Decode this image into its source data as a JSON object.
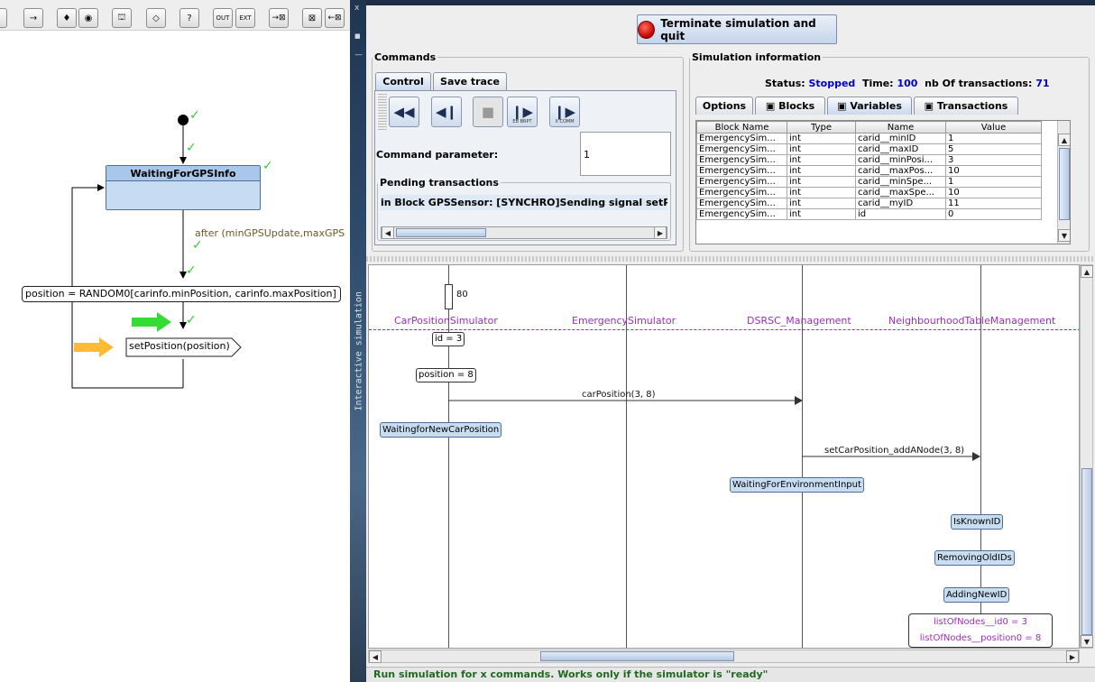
{
  "toolbar": {
    "buttons": [
      {
        "label": "→",
        "icon": "arrow-right-icon"
      },
      {
        "label": "♦",
        "icon": "junction-icon"
      },
      {
        "label": "◉",
        "icon": "stop-state-icon"
      },
      {
        "label": "⛫",
        "icon": "action-state-icon"
      },
      {
        "label": "◇",
        "icon": "choice-icon"
      },
      {
        "label": "?",
        "icon": "receive-icon"
      },
      {
        "label": "OUT",
        "icon": "send-signal-icon"
      },
      {
        "label": "EXT",
        "icon": "external-icon"
      },
      {
        "label": "→⊠",
        "icon": "request-icon"
      },
      {
        "label": "⊠",
        "icon": "clear-icon"
      },
      {
        "label": "←⊠",
        "icon": "receive-request-icon"
      }
    ]
  },
  "diagram": {
    "state_name": "WaitingForGPSInfo",
    "guard": "after (minGPSUpdate,maxGPS",
    "action": "position = RANDOM0[carinfo.minPosition, carinfo.maxPosition]",
    "signal": "setPosition(position)",
    "check": "✓"
  },
  "divider": {
    "vertical_text": "Interactive simulation",
    "icons": [
      "x",
      "■",
      "—"
    ]
  },
  "terminate_button": "Terminate simulation and quit",
  "commands": {
    "legend": "Commands",
    "tabs": [
      "Control",
      "Save trace"
    ],
    "param_label": "Command parameter:",
    "param_value": "1",
    "pending_legend": "Pending transactions",
    "pending_item": "in Block GPSSensor: [SYNCHRO]Sending signal setPosi",
    "btn_labels": {
      "bp": "EB BRPT",
      "xcomm": "X COMM"
    }
  },
  "siminfo": {
    "legend": "Simulation information",
    "status_label": "Status:",
    "status_value": "Stopped",
    "time_label": "Time:",
    "time_value": "100",
    "nb_label": "nb Of transactions:",
    "nb_value": "71",
    "tabs": [
      "Options",
      "Blocks",
      "Variables",
      "Transactions"
    ],
    "columns": [
      "Block Name",
      "Type",
      "Name",
      "Value"
    ],
    "rows": [
      [
        "EmergencySim...",
        "int",
        "carid__minID",
        "1"
      ],
      [
        "EmergencySim...",
        "int",
        "carid__maxID",
        "5"
      ],
      [
        "EmergencySim...",
        "int",
        "carid__minPosi...",
        "3"
      ],
      [
        "EmergencySim...",
        "int",
        "carid__maxPos...",
        "10"
      ],
      [
        "EmergencySim...",
        "int",
        "carid__minSpe...",
        "1"
      ],
      [
        "EmergencySim...",
        "int",
        "carid__maxSpe...",
        "10"
      ],
      [
        "EmergencySim...",
        "int",
        "carid__myID",
        "11"
      ],
      [
        "EmergencySim...",
        "int",
        "id",
        "0"
      ]
    ]
  },
  "sequence": {
    "instances": [
      "CarPositionSimulator",
      "EmergencySimulator",
      "DSRSC_Management",
      "NeighbourhoodTableManagement"
    ],
    "time_box": "80",
    "id_box": "id = 3",
    "position_box": "position = 8",
    "msg1": "carPosition(3, 8)",
    "state1": "WaitingforNewCarPosition",
    "msg2": "setCarPosition_addANode(3, 8)",
    "state2": "WaitingForEnvironmentInput",
    "state3": "IsKnownID",
    "state4": "RemovingOldIDs",
    "state5": "AddingNewID",
    "var1": "listOfNodes__id0 = 3",
    "var2": "listOfNodes__position0 = 8"
  },
  "status_text": "Run simulation for x commands. Works only if the simulator is \"ready\"",
  "colors": {
    "accent": "#0000c8",
    "instance": "#9b2fb9",
    "status": "#1f6a1f",
    "state": "#c8dcf2"
  }
}
